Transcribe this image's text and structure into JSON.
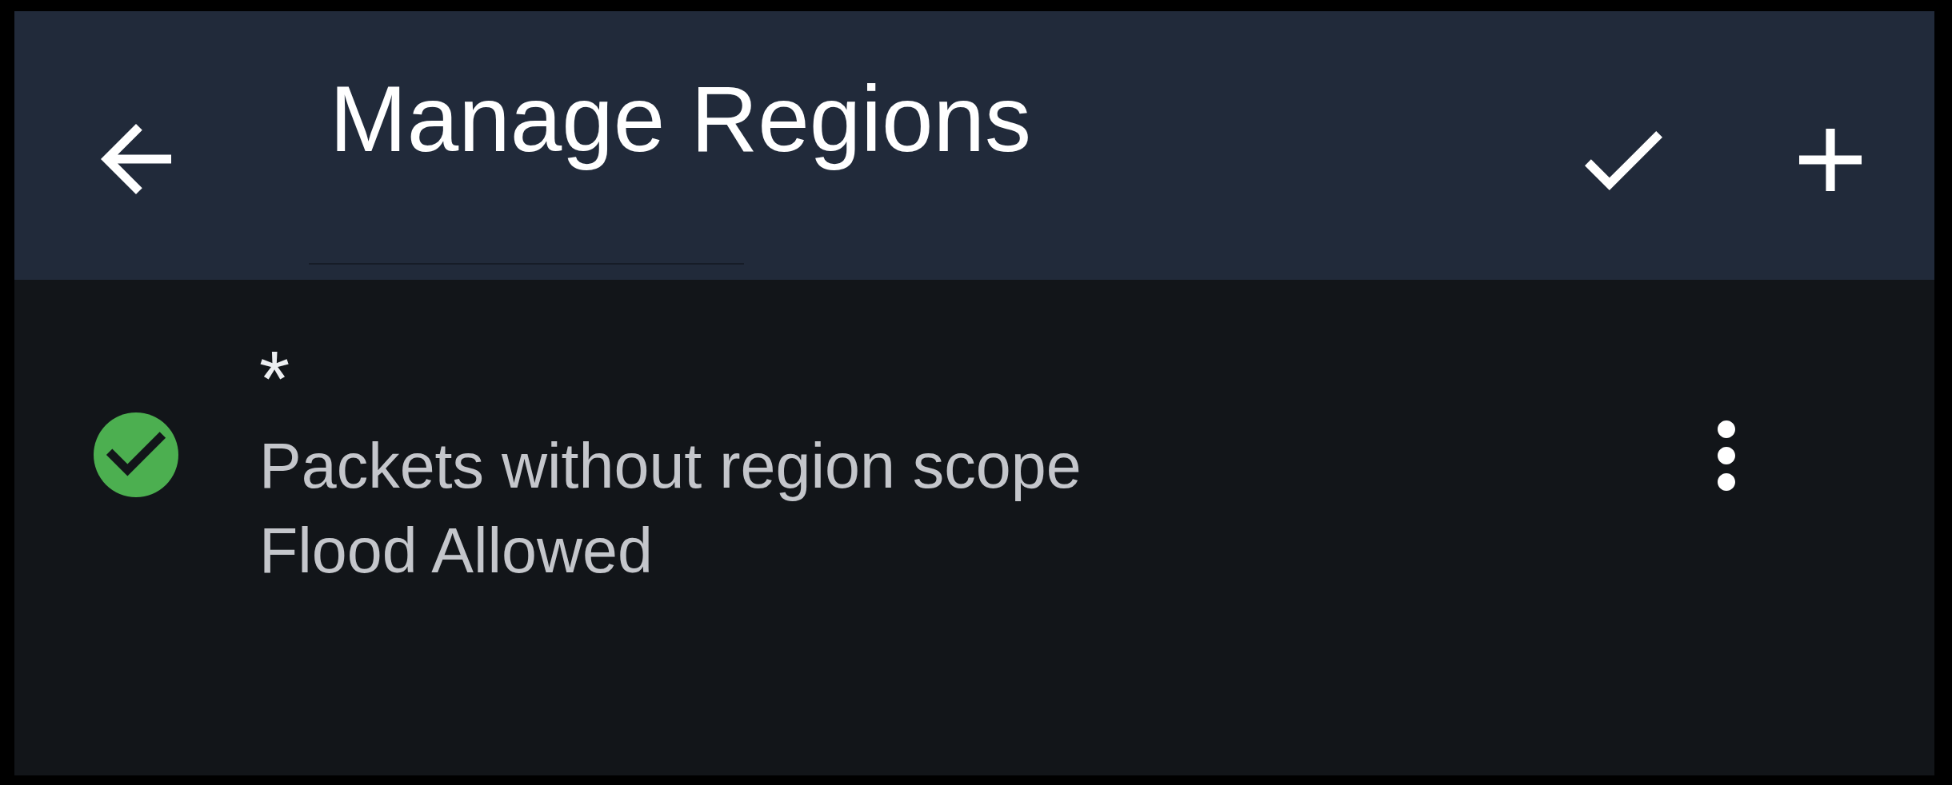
{
  "app_bar": {
    "title": "Manage Regions"
  },
  "regions": [
    {
      "name": "*",
      "description": "Packets without region scope",
      "status": "Flood Allowed",
      "checked": true
    }
  ]
}
